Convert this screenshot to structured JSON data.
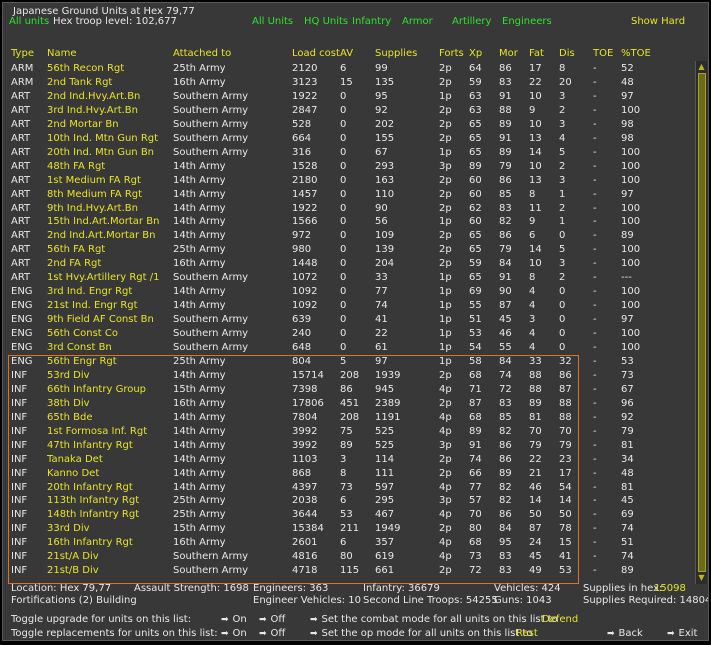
{
  "header": {
    "title": "Japanese Ground Units at Hex 79,77",
    "all_units_label": "All units",
    "troop_level": "Hex troop level: 102,677",
    "show_hard": "Show Hard"
  },
  "filters": [
    "All Units",
    "HQ Units",
    "Infantry",
    "Armor",
    "Artillery",
    "Engineers"
  ],
  "columns": [
    "Type",
    "Name",
    "Attached to",
    "Load cost",
    "AV",
    "Supplies",
    "Forts",
    "Xp",
    "Mor",
    "Fat",
    "Dis",
    "TOE",
    "%TOE"
  ],
  "units": [
    [
      "ARM",
      "56th Recon Rgt",
      "25th Army",
      "2120",
      "6",
      "99",
      "2p",
      "64",
      "86",
      "17",
      "8",
      "-",
      "52"
    ],
    [
      "ARM",
      "2nd Tank Rgt",
      "16th Army",
      "3123",
      "15",
      "135",
      "2p",
      "59",
      "83",
      "22",
      "20",
      "-",
      "48"
    ],
    [
      "ART",
      "2nd Ind.Hvy.Art.Bn",
      "Southern Army",
      "1922",
      "0",
      "95",
      "1p",
      "63",
      "91",
      "10",
      "3",
      "-",
      "97"
    ],
    [
      "ART",
      "3rd Ind.Hvy.Art.Bn",
      "Southern Army",
      "2847",
      "0",
      "92",
      "2p",
      "63",
      "88",
      "9",
      "2",
      "-",
      "100"
    ],
    [
      "ART",
      "2nd Mortar Bn",
      "Southern Army",
      "528",
      "0",
      "202",
      "2p",
      "65",
      "89",
      "10",
      "3",
      "-",
      "98"
    ],
    [
      "ART",
      "10th Ind. Mtn Gun Rgt",
      "Southern Army",
      "664",
      "0",
      "155",
      "2p",
      "65",
      "91",
      "13",
      "4",
      "-",
      "98"
    ],
    [
      "ART",
      "20th Ind. Mtn Gun Bn",
      "Southern Army",
      "316",
      "0",
      "67",
      "1p",
      "65",
      "89",
      "14",
      "5",
      "-",
      "100"
    ],
    [
      "ART",
      "48th FA Rgt",
      "14th Army",
      "1528",
      "0",
      "293",
      "3p",
      "89",
      "79",
      "10",
      "2",
      "-",
      "100"
    ],
    [
      "ART",
      "1st Medium FA Rgt",
      "14th Army",
      "2180",
      "0",
      "163",
      "2p",
      "60",
      "86",
      "13",
      "3",
      "-",
      "100"
    ],
    [
      "ART",
      "8th Medium FA Rgt",
      "14th Army",
      "1457",
      "0",
      "110",
      "2p",
      "60",
      "85",
      "8",
      "1",
      "-",
      "97"
    ],
    [
      "ART",
      "9th Ind.Hvy.Art.Bn",
      "14th Army",
      "1922",
      "0",
      "90",
      "2p",
      "62",
      "83",
      "11",
      "2",
      "-",
      "100"
    ],
    [
      "ART",
      "15th Ind.Art.Mortar Bn",
      "14th Army",
      "1566",
      "0",
      "56",
      "1p",
      "60",
      "82",
      "9",
      "1",
      "-",
      "100"
    ],
    [
      "ART",
      "2nd Ind.Art.Mortar Bn",
      "14th Army",
      "972",
      "0",
      "109",
      "2p",
      "65",
      "86",
      "6",
      "0",
      "-",
      "89"
    ],
    [
      "ART",
      "56th FA Rgt",
      "25th Army",
      "980",
      "0",
      "139",
      "2p",
      "65",
      "79",
      "14",
      "5",
      "-",
      "100"
    ],
    [
      "ART",
      "2nd FA Rgt",
      "16th Army",
      "1448",
      "0",
      "204",
      "2p",
      "59",
      "84",
      "10",
      "3",
      "-",
      "100"
    ],
    [
      "ART",
      "1st Hvy.Artillery Rgt /1",
      "Southern Army",
      "1072",
      "0",
      "33",
      "1p",
      "65",
      "91",
      "8",
      "2",
      "-",
      "---"
    ],
    [
      "ENG",
      "3rd Ind. Engr Rgt",
      "14th Army",
      "1092",
      "0",
      "77",
      "1p",
      "69",
      "90",
      "4",
      "0",
      "-",
      "100"
    ],
    [
      "ENG",
      "21st Ind. Engr Rgt",
      "14th Army",
      "1092",
      "0",
      "74",
      "1p",
      "55",
      "87",
      "4",
      "0",
      "-",
      "100"
    ],
    [
      "ENG",
      "9th Field AF Const Bn",
      "Southern Army",
      "639",
      "0",
      "41",
      "1p",
      "51",
      "45",
      "3",
      "0",
      "-",
      "97"
    ],
    [
      "ENG",
      "56th Const Co",
      "Southern Army",
      "240",
      "0",
      "22",
      "1p",
      "53",
      "46",
      "4",
      "0",
      "-",
      "100"
    ],
    [
      "ENG",
      "3rd Const Bn",
      "Southern Army",
      "648",
      "0",
      "61",
      "1p",
      "54",
      "55",
      "4",
      "0",
      "-",
      "100"
    ],
    [
      "ENG",
      "56th Engr Rgt",
      "25th Army",
      "804",
      "5",
      "97",
      "1p",
      "58",
      "84",
      "33",
      "32",
      "-",
      "53"
    ],
    [
      "INF",
      "53rd Div",
      "14th Army",
      "15714",
      "208",
      "1939",
      "2p",
      "68",
      "74",
      "88",
      "86",
      "-",
      "73"
    ],
    [
      "INF",
      "66th Infantry Group",
      "15th Army",
      "7398",
      "86",
      "945",
      "4p",
      "71",
      "72",
      "88",
      "87",
      "-",
      "67"
    ],
    [
      "INF",
      "38th Div",
      "16th Army",
      "17806",
      "451",
      "2389",
      "2p",
      "87",
      "83",
      "89",
      "88",
      "-",
      "96"
    ],
    [
      "INF",
      "65th Bde",
      "14th Army",
      "7804",
      "208",
      "1191",
      "4p",
      "68",
      "85",
      "81",
      "88",
      "-",
      "92"
    ],
    [
      "INF",
      "1st Formosa Inf. Rgt",
      "14th Army",
      "3992",
      "75",
      "525",
      "4p",
      "89",
      "82",
      "70",
      "70",
      "-",
      "79"
    ],
    [
      "INF",
      "47th Infantry Rgt",
      "14th Army",
      "3992",
      "89",
      "525",
      "3p",
      "91",
      "86",
      "79",
      "79",
      "-",
      "81"
    ],
    [
      "INF",
      "Tanaka Det",
      "14th Army",
      "1103",
      "3",
      "114",
      "2p",
      "74",
      "86",
      "22",
      "23",
      "-",
      "34"
    ],
    [
      "INF",
      "Kanno Det",
      "14th Army",
      "868",
      "8",
      "111",
      "2p",
      "66",
      "89",
      "21",
      "17",
      "-",
      "48"
    ],
    [
      "INF",
      "20th Infantry Rgt",
      "14th Army",
      "4397",
      "73",
      "597",
      "4p",
      "77",
      "82",
      "46",
      "54",
      "-",
      "81"
    ],
    [
      "INF",
      "113th Infantry Rgt",
      "25th Army",
      "2038",
      "6",
      "295",
      "3p",
      "57",
      "82",
      "14",
      "14",
      "-",
      "45"
    ],
    [
      "INF",
      "148th Infantry Rgt",
      "25th Army",
      "3644",
      "53",
      "467",
      "4p",
      "70",
      "86",
      "50",
      "50",
      "-",
      "69"
    ],
    [
      "INF",
      "33rd Div",
      "15th Army",
      "15384",
      "211",
      "1949",
      "2p",
      "80",
      "84",
      "87",
      "78",
      "-",
      "74"
    ],
    [
      "INF",
      "16th Infantry Rgt",
      "16th Army",
      "2601",
      "6",
      "357",
      "4p",
      "68",
      "95",
      "24",
      "15",
      "-",
      "51"
    ],
    [
      "INF",
      "21st/A Div",
      "Southern Army",
      "4816",
      "80",
      "619",
      "4p",
      "73",
      "83",
      "45",
      "41",
      "-",
      "74"
    ],
    [
      "INF",
      "21st/B Div",
      "Southern Army",
      "4718",
      "115",
      "661",
      "2p",
      "72",
      "83",
      "49",
      "53",
      "-",
      "89"
    ]
  ],
  "footer": {
    "location": "Location: Hex 79,77",
    "assault": "Assault Strength: 1698",
    "engineers": "Engineers: 363",
    "infantry": "Infantry: 36679",
    "vehicles": "Vehicles: 424",
    "supplies_in_hex_label": "Supplies in hex:",
    "supplies_in_hex_value": "15098",
    "fortifications": "Fortifications (2) Building",
    "engineer_vehicles": "Engineer Vehicles: 10",
    "second_line": "Second Line Troops: 54255",
    "guns": "Guns: 1043",
    "supplies_required": "Supplies Required: 14804",
    "toggle_upgrade": "Toggle upgrade for units on this list:",
    "toggle_replacements": "Toggle replacements for units on this list:",
    "on": "On",
    "off": "Off",
    "combat_mode_text": "Set the combat mode for all units on this list to",
    "combat_mode_value": "Defend",
    "op_mode_text": "Set the op mode for all units on this list to",
    "op_mode_value": "Rest",
    "back": "Back",
    "exit": "Exit"
  }
}
